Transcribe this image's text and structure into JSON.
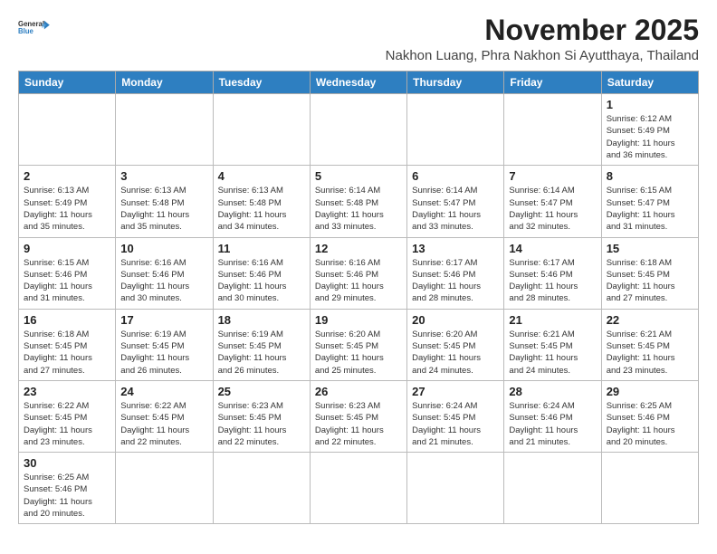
{
  "header": {
    "logo_line1": "General",
    "logo_line2": "Blue",
    "month_title": "November 2025",
    "location": "Nakhon Luang, Phra Nakhon Si Ayutthaya, Thailand"
  },
  "weekdays": [
    "Sunday",
    "Monday",
    "Tuesday",
    "Wednesday",
    "Thursday",
    "Friday",
    "Saturday"
  ],
  "weeks": [
    [
      {
        "day": "",
        "info": ""
      },
      {
        "day": "",
        "info": ""
      },
      {
        "day": "",
        "info": ""
      },
      {
        "day": "",
        "info": ""
      },
      {
        "day": "",
        "info": ""
      },
      {
        "day": "",
        "info": ""
      },
      {
        "day": "1",
        "info": "Sunrise: 6:12 AM\nSunset: 5:49 PM\nDaylight: 11 hours\nand 36 minutes."
      }
    ],
    [
      {
        "day": "2",
        "info": "Sunrise: 6:13 AM\nSunset: 5:49 PM\nDaylight: 11 hours\nand 35 minutes."
      },
      {
        "day": "3",
        "info": "Sunrise: 6:13 AM\nSunset: 5:48 PM\nDaylight: 11 hours\nand 35 minutes."
      },
      {
        "day": "4",
        "info": "Sunrise: 6:13 AM\nSunset: 5:48 PM\nDaylight: 11 hours\nand 34 minutes."
      },
      {
        "day": "5",
        "info": "Sunrise: 6:14 AM\nSunset: 5:48 PM\nDaylight: 11 hours\nand 33 minutes."
      },
      {
        "day": "6",
        "info": "Sunrise: 6:14 AM\nSunset: 5:47 PM\nDaylight: 11 hours\nand 33 minutes."
      },
      {
        "day": "7",
        "info": "Sunrise: 6:14 AM\nSunset: 5:47 PM\nDaylight: 11 hours\nand 32 minutes."
      },
      {
        "day": "8",
        "info": "Sunrise: 6:15 AM\nSunset: 5:47 PM\nDaylight: 11 hours\nand 31 minutes."
      }
    ],
    [
      {
        "day": "9",
        "info": "Sunrise: 6:15 AM\nSunset: 5:46 PM\nDaylight: 11 hours\nand 31 minutes."
      },
      {
        "day": "10",
        "info": "Sunrise: 6:16 AM\nSunset: 5:46 PM\nDaylight: 11 hours\nand 30 minutes."
      },
      {
        "day": "11",
        "info": "Sunrise: 6:16 AM\nSunset: 5:46 PM\nDaylight: 11 hours\nand 30 minutes."
      },
      {
        "day": "12",
        "info": "Sunrise: 6:16 AM\nSunset: 5:46 PM\nDaylight: 11 hours\nand 29 minutes."
      },
      {
        "day": "13",
        "info": "Sunrise: 6:17 AM\nSunset: 5:46 PM\nDaylight: 11 hours\nand 28 minutes."
      },
      {
        "day": "14",
        "info": "Sunrise: 6:17 AM\nSunset: 5:46 PM\nDaylight: 11 hours\nand 28 minutes."
      },
      {
        "day": "15",
        "info": "Sunrise: 6:18 AM\nSunset: 5:45 PM\nDaylight: 11 hours\nand 27 minutes."
      }
    ],
    [
      {
        "day": "16",
        "info": "Sunrise: 6:18 AM\nSunset: 5:45 PM\nDaylight: 11 hours\nand 27 minutes."
      },
      {
        "day": "17",
        "info": "Sunrise: 6:19 AM\nSunset: 5:45 PM\nDaylight: 11 hours\nand 26 minutes."
      },
      {
        "day": "18",
        "info": "Sunrise: 6:19 AM\nSunset: 5:45 PM\nDaylight: 11 hours\nand 26 minutes."
      },
      {
        "day": "19",
        "info": "Sunrise: 6:20 AM\nSunset: 5:45 PM\nDaylight: 11 hours\nand 25 minutes."
      },
      {
        "day": "20",
        "info": "Sunrise: 6:20 AM\nSunset: 5:45 PM\nDaylight: 11 hours\nand 24 minutes."
      },
      {
        "day": "21",
        "info": "Sunrise: 6:21 AM\nSunset: 5:45 PM\nDaylight: 11 hours\nand 24 minutes."
      },
      {
        "day": "22",
        "info": "Sunrise: 6:21 AM\nSunset: 5:45 PM\nDaylight: 11 hours\nand 23 minutes."
      }
    ],
    [
      {
        "day": "23",
        "info": "Sunrise: 6:22 AM\nSunset: 5:45 PM\nDaylight: 11 hours\nand 23 minutes."
      },
      {
        "day": "24",
        "info": "Sunrise: 6:22 AM\nSunset: 5:45 PM\nDaylight: 11 hours\nand 22 minutes."
      },
      {
        "day": "25",
        "info": "Sunrise: 6:23 AM\nSunset: 5:45 PM\nDaylight: 11 hours\nand 22 minutes."
      },
      {
        "day": "26",
        "info": "Sunrise: 6:23 AM\nSunset: 5:45 PM\nDaylight: 11 hours\nand 22 minutes."
      },
      {
        "day": "27",
        "info": "Sunrise: 6:24 AM\nSunset: 5:45 PM\nDaylight: 11 hours\nand 21 minutes."
      },
      {
        "day": "28",
        "info": "Sunrise: 6:24 AM\nSunset: 5:46 PM\nDaylight: 11 hours\nand 21 minutes."
      },
      {
        "day": "29",
        "info": "Sunrise: 6:25 AM\nSunset: 5:46 PM\nDaylight: 11 hours\nand 20 minutes."
      }
    ],
    [
      {
        "day": "30",
        "info": "Sunrise: 6:25 AM\nSunset: 5:46 PM\nDaylight: 11 hours\nand 20 minutes."
      },
      {
        "day": "",
        "info": ""
      },
      {
        "day": "",
        "info": ""
      },
      {
        "day": "",
        "info": ""
      },
      {
        "day": "",
        "info": ""
      },
      {
        "day": "",
        "info": ""
      },
      {
        "day": "",
        "info": ""
      }
    ]
  ]
}
